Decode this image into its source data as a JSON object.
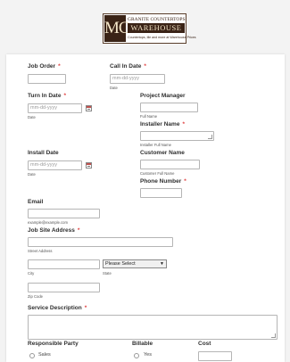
{
  "logo": {
    "mark": "MC",
    "line1": "GRANITE COUNTERTOPS",
    "line2": "WAREHOUSE",
    "tagline": "Countertops, tile and more at Warehouse Prices"
  },
  "fields": {
    "job_order": {
      "label": "Job Order",
      "required": "*"
    },
    "call_in_date": {
      "label": "Call In Date",
      "required": "*",
      "placeholder": "mm-dd-yyyy",
      "sublabel": "Date"
    },
    "turn_in_date": {
      "label": "Turn In Date",
      "required": "*",
      "placeholder": "mm-dd-yyyy",
      "sublabel": "Date"
    },
    "project_manager": {
      "label": "Project Manager",
      "sublabel": "Full Name"
    },
    "installer_name": {
      "label": "Installer Name",
      "required": "*",
      "sublabel": "Installer Full Name"
    },
    "install_date": {
      "label": "Install Date",
      "placeholder": "mm-dd-yyyy",
      "sublabel": "Date"
    },
    "customer_name": {
      "label": "Customer Name",
      "sublabel": "Customer Full Name"
    },
    "phone_number": {
      "label": "Phone Number",
      "required": "*"
    },
    "email": {
      "label": "Email",
      "sublabel": "example@example.com"
    },
    "job_site_address": {
      "label": "Job Site Address",
      "required": "*",
      "street_sublabel": "Street Address",
      "city_sublabel": "City",
      "state_sublabel": "State",
      "state_selected": "Please Select",
      "zip_sublabel": "Zip Code"
    },
    "service_description": {
      "label": "Service Description",
      "required": "*"
    },
    "responsible_party": {
      "label": "Responsible Party",
      "option1": "Sales"
    },
    "billable": {
      "label": "Billable",
      "option1": "Yes"
    },
    "cost": {
      "label": "Cost"
    }
  }
}
